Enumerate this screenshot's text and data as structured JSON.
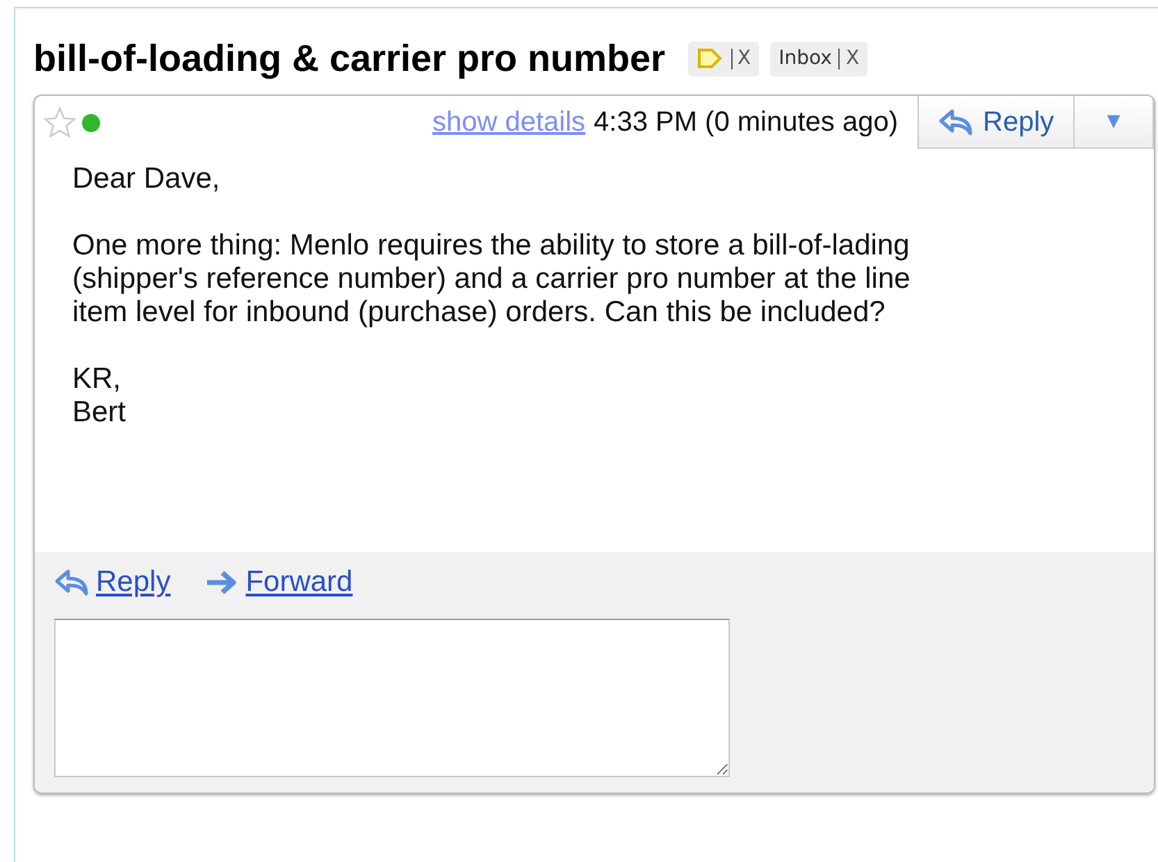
{
  "subject": "bill-of-loading & carrier pro number",
  "labels": [
    {
      "kind": "tag",
      "remove": "X"
    },
    {
      "kind": "text",
      "text": "Inbox",
      "remove": "X"
    }
  ],
  "message": {
    "starred": false,
    "sender_online": true,
    "show_details": "show details",
    "time": "4:33 PM (0 minutes ago)",
    "reply_button": "Reply",
    "menu_caret": "▼",
    "paragraphs": [
      [
        "Dear Dave,"
      ],
      [
        "One more thing: Menlo requires the ability to store a bill-of-lading",
        "(shipper's reference number) and a carrier pro number at the line",
        "item level for inbound (purchase) orders. Can this be included?"
      ],
      [
        "KR,",
        "Bert"
      ]
    ]
  },
  "footer": {
    "reply": "Reply",
    "forward": "Forward"
  }
}
